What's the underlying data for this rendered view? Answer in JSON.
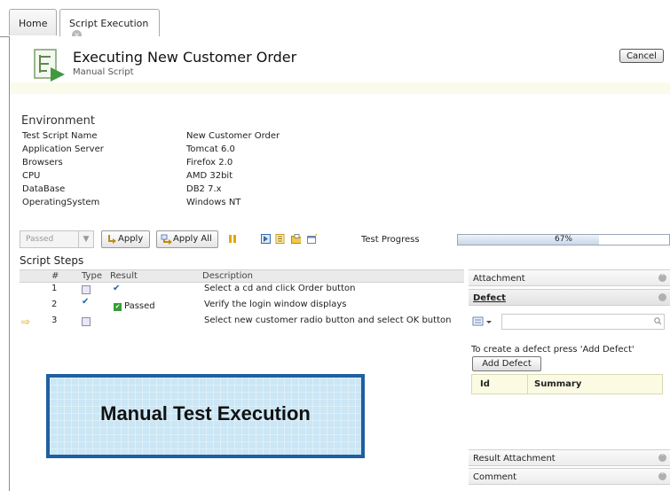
{
  "tabs": [
    {
      "label": "Home"
    },
    {
      "label": "Script Execution",
      "close": "×"
    }
  ],
  "header": {
    "title": "Executing New Customer Order",
    "subtitle": "Manual Script",
    "cancel_label": "Cancel",
    "icon": "script-icon"
  },
  "environment": {
    "title": "Environment",
    "rows": [
      {
        "label": "Test Script Name",
        "value": "New Customer Order"
      },
      {
        "label": "Application Server",
        "value": "Tomcat 6.0"
      },
      {
        "label": "Browsers",
        "value": "Firefox 2.0"
      },
      {
        "label": "CPU",
        "value": "AMD 32bit"
      },
      {
        "label": "DataBase",
        "value": "DB2 7.x"
      },
      {
        "label": "OperatingSystem",
        "value": "Windows NT"
      }
    ]
  },
  "toolbar": {
    "status_value": "Passed",
    "apply_label": "Apply",
    "apply_all_label": "Apply All",
    "progress_label": "Test Progress",
    "progress_text": "67%",
    "progress_fraction": 0.67
  },
  "steps": {
    "title": "Script Steps",
    "headers": {
      "num": "#",
      "type": "Type",
      "result": "Result",
      "description": "Description"
    },
    "rows": [
      {
        "num": "1",
        "result": "✔",
        "description": "Select a cd and click Order button"
      },
      {
        "num": "2",
        "result": "Passed",
        "description": "Verify the login window displays"
      },
      {
        "num": "3",
        "result": "",
        "description": "Select new customer radio button and select OK button"
      }
    ],
    "current_indicator": "⇨"
  },
  "overlay": {
    "text": "Manual Test Execution"
  },
  "panel": {
    "attachment": "Attachment",
    "defect": "Defect",
    "defect_search_value": "",
    "defect_hint": "To create a defect press 'Add Defect'",
    "add_defect_label": "Add Defect",
    "table_headers": {
      "id": "Id",
      "summary": "Summary"
    },
    "result_attachment": "Result Attachment",
    "comment": "Comment"
  },
  "colors": {
    "accent": "#1f5fa0",
    "overlay_bg": "#cbe6f5",
    "check_blue": "#1a62b4",
    "pass_green": "#3a9a3a",
    "header_band": "#fbfbeb"
  }
}
